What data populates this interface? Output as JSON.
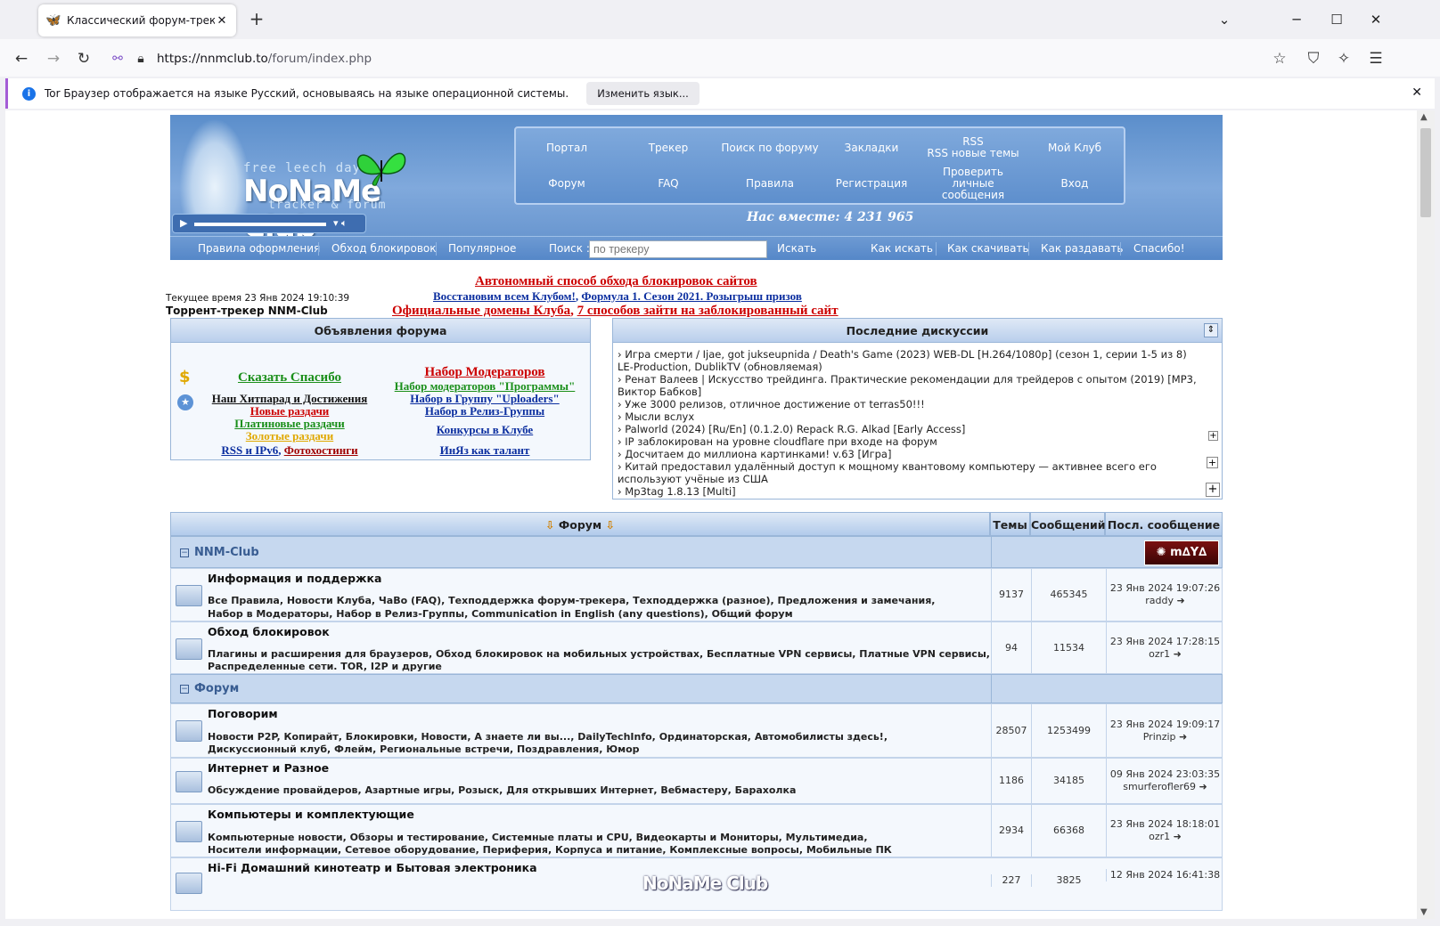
{
  "browser": {
    "tab_title": "Классический форум-трекер",
    "new_tab": "+",
    "url_host": "https://nnmclub.to",
    "url_path": "/forum/index.php",
    "infobar_text": "Tor Браузер отображается на языке Русский, основываясь на языке операционной системы.",
    "infobar_button": "Изменить язык..."
  },
  "site": {
    "logo_top": "free leech day",
    "logo_name": "NoNaMe Club",
    "logo_bottom": "tracker & forum",
    "menu": [
      {
        "label": "Портал"
      },
      {
        "label": "Трекер"
      },
      {
        "label": "Поиск по форуму"
      },
      {
        "label": "Закладки"
      },
      {
        "label": "RSS\nRSS новые темы"
      },
      {
        "label": "Мой Клуб"
      },
      {
        "label": "Форум"
      },
      {
        "label": "FAQ"
      },
      {
        "label": "Правила"
      },
      {
        "label": "Регистрация"
      },
      {
        "label": "Проверить личные сообщения"
      },
      {
        "label": "Вход"
      }
    ],
    "together": "Нас вместе: 4 231 965",
    "subnav": {
      "rules": "Правила оформления",
      "bypass": "Обход блокировок",
      "popular": "Популярное",
      "search_label": "Поиск :",
      "search_placeholder": "по трекеру",
      "search_button": "Искать",
      "how_search": "Как искать",
      "how_download": "Как скачивать",
      "how_seed": "Как раздавать",
      "thanks": "Спасибо!"
    },
    "ticker": {
      "line1": "Автономный способ обхода блокировок сайтов",
      "line2a": "Восстановим всем Клубом!",
      "line2b": "Формула 1. Сезон 2021. Розыгрыш призов",
      "line3a": "Официальные домены Клуба",
      "line3b": "7 способов зайти на заблокированный сайт"
    },
    "current_time": "Текущее время 23 Янв 2024 19:10:39",
    "tracker_name": "Торрент-трекер NNM-Club"
  },
  "announcements": {
    "title": "Объявления форума",
    "left": [
      "Сказать Спасибо",
      "Наш Хитпарад и Достижения",
      "Новые раздачи",
      "Платиновые раздачи",
      "Золотые раздачи",
      "RSS и IPv6",
      "Фотохостинги"
    ],
    "right": [
      "Набор Модераторов",
      "Набор модераторов \"Программы\"",
      "Набор в Группу \"Uploaders\"",
      "Набор в Релиз-Группы",
      "Конкурсы в Клубе",
      "ИнЯз как талант"
    ]
  },
  "discussions": {
    "title": "Последние дискуссии",
    "items": [
      "Игра смерти / Ijae, got jukseupnida / Death's Game (2023) WEB-DL [H.264/1080p] (сезон 1, серии 1-5 из 8) LE-Production, DublikTV (обновляемая)",
      "Ренат Валеев | Искусство трейдинга. Практические рекомендации для трейдеров с опытом (2019) [MP3, Виктор Бабков]",
      "Уже 3000 релизов, отличное достижение от terras50!!!",
      "Мысли вслух",
      "Palworld (2024) [Ru/En] (0.1.2.0) Repack R.G. Alkad [Early Access]",
      "IP заблокирован на уровне cloudflare при входе на форум",
      "Досчитаем до миллиона картинками! v.63 [Игра]",
      "Китай предоставил удалённый доступ к мощному квантовому компьютеру — активнее всего его используют учёные из США",
      "Mp3tag 1.8.13 [Multi]"
    ]
  },
  "forum": {
    "col_forum": "Форум",
    "col_topics": "Темы",
    "col_posts": "Сообщений",
    "col_last": "Посл. сообщение",
    "categories": [
      {
        "name": "NNM-Club"
      },
      {
        "name": "Форум"
      }
    ],
    "rows": [
      {
        "name": "Информация и поддержка",
        "sub1": "Все Правила, Новости Клуба, ЧаВо (FAQ), Техподдержка форум-трекера, Техподдержка (разное), Предложения и замечания,",
        "sub2": "Набор в Модераторы, Набор в Релиз-Группы, Communication in English (any questions), Общий форум",
        "topics": "9137",
        "posts": "465345",
        "last_date": "23 Янв 2024 19:07:26",
        "last_user": "raddy"
      },
      {
        "name": "Обход блокировок",
        "sub1": "Плагины и расширения для браузеров, Обход блокировок на мобильных устройствах, Бесплатные VPN сервисы, Платные VPN сервисы,",
        "sub2": "Распределенные сети. TOR, I2P и другие",
        "topics": "94",
        "posts": "11534",
        "last_date": "23 Янв 2024 17:28:15",
        "last_user": "ozr1"
      },
      {
        "name": "Поговорим",
        "sub1": "Новости P2P, Копирайт, Блокировки, Новости, А знаете ли вы..., DailyTechInfo, Ординаторская, Автомобилисты здесь!,",
        "sub2": "Дискуссионный клуб, Флейм, Региональные встречи, Поздравления, Юмор",
        "topics": "28507",
        "posts": "1253499",
        "last_date": "23 Янв 2024 19:09:17",
        "last_user": "Prinzip"
      },
      {
        "name": "Интернет и Разное",
        "sub1": "Обсуждение провайдеров, Азартные игры, Розыск, Для открывших Интернет, Вебмастеру, Барахолка",
        "sub2": "",
        "topics": "1186",
        "posts": "34185",
        "last_date": "09 Янв 2024 23:03:35",
        "last_user": "smurferofler69"
      },
      {
        "name": "Компьютеры и комплектующие",
        "sub1": "Компьютерные новости, Обзоры и тестирование, Системные платы и CPU, Видеокарты и Мониторы, Мультимедиа,",
        "sub2": "Носители информации, Сетевое оборудование, Периферия, Корпуса и питание, Комплексные вопросы, Мобильные ПК",
        "topics": "2934",
        "posts": "66368",
        "last_date": "23 Янв 2024 18:18:01",
        "last_user": "ozr1"
      },
      {
        "name": "Hi-Fi Домашний кинотеатр и Бытовая электроника",
        "sub1": "",
        "sub2": "",
        "topics": "227",
        "posts": "3825",
        "last_date": "12 Янв 2024 16:41:38",
        "last_user": ""
      }
    ],
    "watermark": "NoNaMe Club"
  },
  "colors": {
    "accent": "#5b8ecb",
    "link_red": "#cc0000",
    "link_blue": "#0b2e9f"
  }
}
